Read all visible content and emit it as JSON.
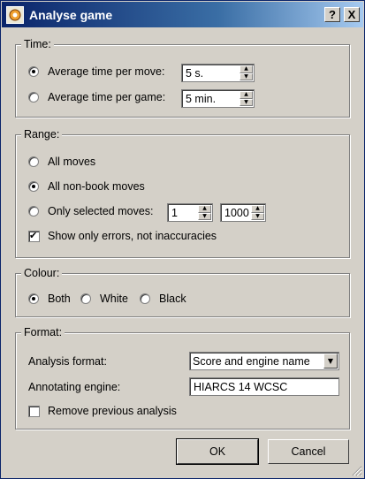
{
  "window": {
    "title": "Analyse game",
    "help_label": "?",
    "close_label": "X"
  },
  "time": {
    "legend": "Time:",
    "options": [
      {
        "label": "Average time per move:",
        "value": "5 s.",
        "selected": true
      },
      {
        "label": "Average time per game:",
        "value": "5 min.",
        "selected": false
      }
    ]
  },
  "range": {
    "legend": "Range:",
    "all_moves": "All moves",
    "all_non_book": "All non-book moves",
    "only_selected": "Only selected moves:",
    "from_value": "1",
    "to_value": "1000",
    "show_errors": "Show only errors, not inaccuracies",
    "show_errors_checked": true,
    "selected_option": "all_non_book"
  },
  "colour": {
    "legend": "Colour:",
    "options": [
      "Both",
      "White",
      "Black"
    ],
    "selected": "Both"
  },
  "format": {
    "legend": "Format:",
    "analysis_format_label": "Analysis format:",
    "analysis_format_value": "Score and engine name",
    "annotating_engine_label": "Annotating engine:",
    "annotating_engine_value": "HIARCS 14 WCSC",
    "remove_previous": "Remove previous analysis",
    "remove_previous_checked": false
  },
  "buttons": {
    "ok": "OK",
    "cancel": "Cancel"
  }
}
